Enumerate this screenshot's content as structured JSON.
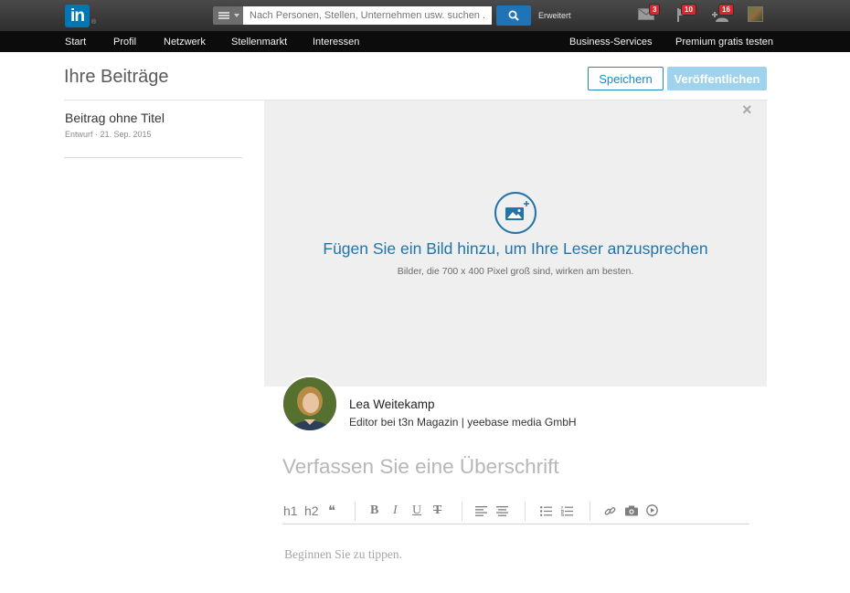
{
  "topbar": {
    "logo_text": "in",
    "logo_reg": "®",
    "search_placeholder": "Nach Personen, Stellen, Unternehmen usw. suchen ...",
    "advanced_label": "Erweitert",
    "messages_count": "3",
    "notifications_count": "10",
    "invitations_count": "16",
    "brand_color": "#0077b5"
  },
  "nav": {
    "items": [
      "Start",
      "Profil",
      "Netzwerk",
      "Stellenmarkt",
      "Interessen"
    ],
    "right_items": [
      "Business-Services",
      "Premium gratis testen"
    ]
  },
  "header": {
    "title": "Ihre Beiträge",
    "save_label": "Speichern",
    "publish_label": "Veröffentlichen"
  },
  "sidebar": {
    "draft_title": "Beitrag ohne Titel",
    "draft_meta": "Entwurf · 21. Sep. 2015"
  },
  "image_zone": {
    "headline": "Fügen Sie ein Bild hinzu, um Ihre Leser anzusprechen",
    "hint": "Bilder, die 700 x 400 Pixel groß sind, wirken am besten.",
    "accent_color": "#2274a8"
  },
  "author": {
    "name": "Lea Weitekamp",
    "role": "Editor bei t3n Magazin | yeebase media GmbH"
  },
  "editor": {
    "headline_placeholder": "Verfassen Sie eine Überschrift",
    "body_placeholder": "Beginnen Sie zu tippen.",
    "toolbar": {
      "h1": "h1",
      "h2": "h2",
      "quote": "❝",
      "bold": "B",
      "italic": "I",
      "underline": "U",
      "strike": "T"
    }
  }
}
